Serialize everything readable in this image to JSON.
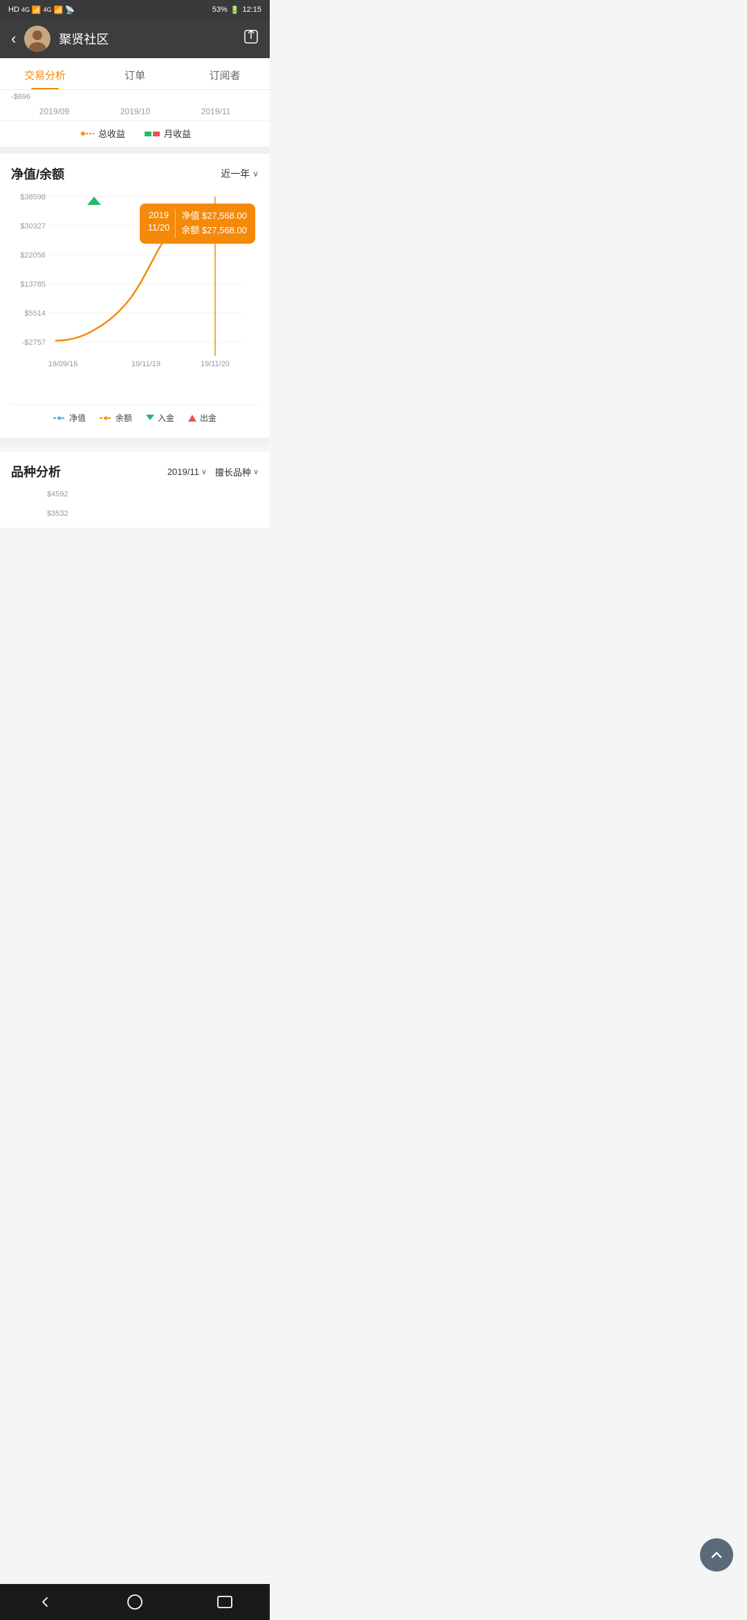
{
  "statusBar": {
    "left": "HD 4G 4G",
    "battery": "53%",
    "time": "12:15"
  },
  "header": {
    "title": "聚贤社区",
    "backLabel": "‹",
    "shareIcon": "share"
  },
  "tabs": [
    {
      "id": "trading",
      "label": "交易分析",
      "active": true
    },
    {
      "id": "orders",
      "label": "订单",
      "active": false
    },
    {
      "id": "subscribers",
      "label": "订阅者",
      "active": false
    }
  ],
  "topChart": {
    "negativeLabel": "-$696",
    "periods": [
      "2019/09",
      "2019/10",
      "2019/11"
    ],
    "legend": [
      {
        "label": "总收益",
        "color": "#f5890a"
      },
      {
        "label": "月收益",
        "color": "#f05050"
      }
    ]
  },
  "netValueSection": {
    "title": "净值/余额",
    "filterLabel": "近一年",
    "yLabels": [
      "$38598",
      "$30327",
      "$22056",
      "$13785",
      "$5514",
      "-$2757"
    ],
    "xLabels": [
      "19/09/16",
      "19/11/19",
      "19/11/20"
    ],
    "tooltip": {
      "date": "2019\n11/20",
      "netValue": "净值 $27,568.00",
      "balance": "余额 $27,568.00"
    },
    "legend": [
      {
        "label": "净值",
        "type": "blue-dash",
        "color": "#4da6e8"
      },
      {
        "label": "余额",
        "type": "orange-dash",
        "color": "#f5890a"
      },
      {
        "label": "入金",
        "type": "triangle-down",
        "color": "#27b96a"
      },
      {
        "label": "出金",
        "type": "triangle-up",
        "color": "#f05050"
      }
    ]
  },
  "varietySection": {
    "title": "品种分析",
    "dateFilter": "2019/11",
    "typeFilter": "擅长品种",
    "yLabels": [
      "$4592",
      "$3532"
    ]
  },
  "bottomNav": {
    "back": "◁",
    "home": "○",
    "recent": "□"
  },
  "fab": {
    "icon": "∧"
  }
}
